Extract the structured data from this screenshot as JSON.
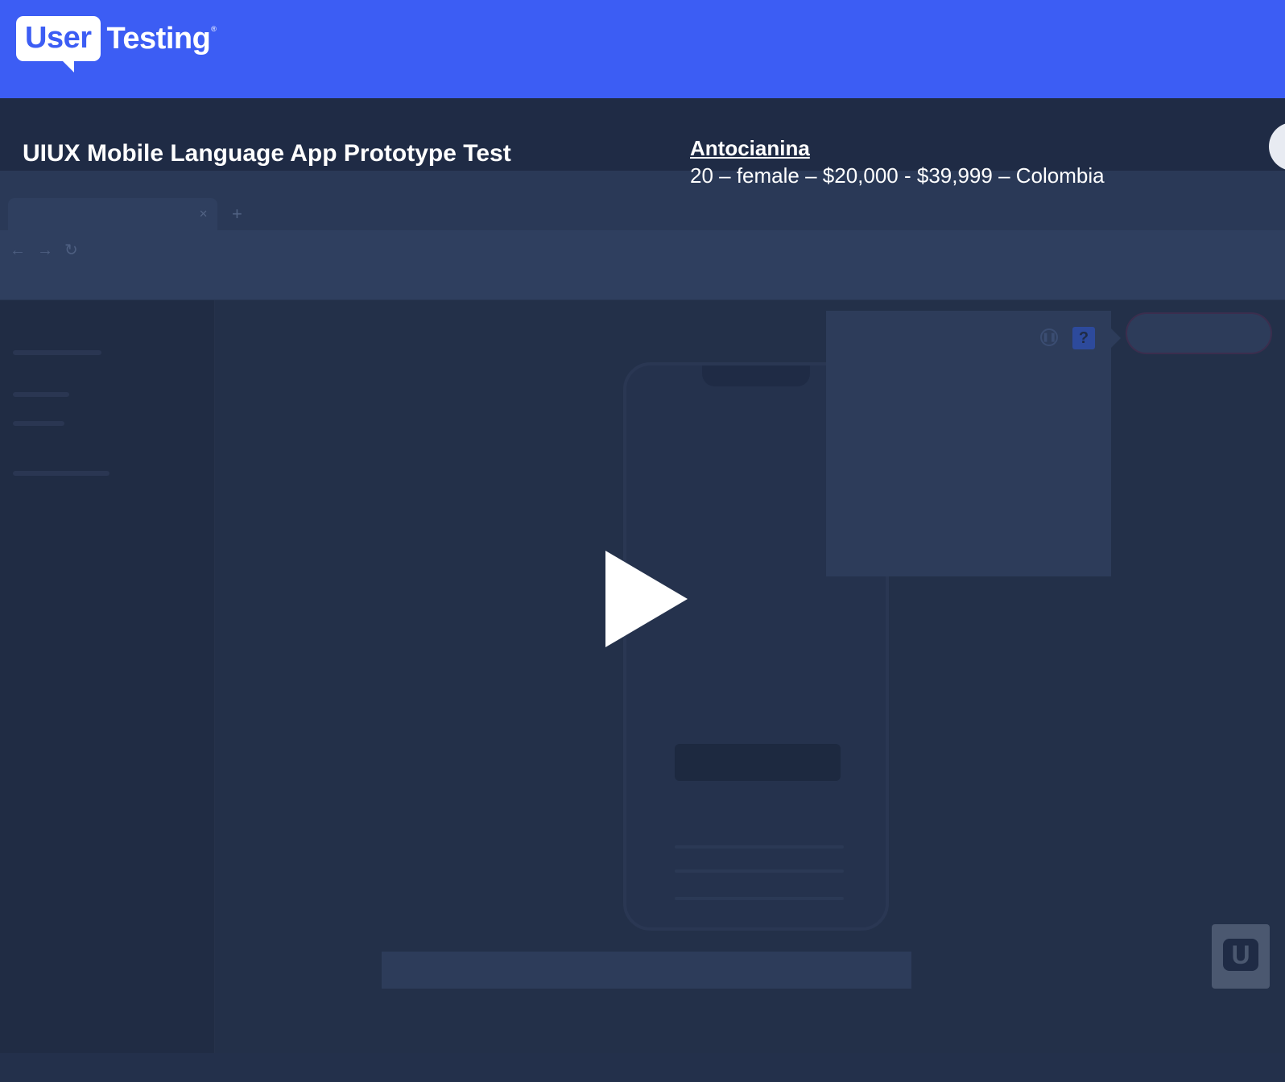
{
  "brand": {
    "logo_user": "User",
    "logo_testing": "Testing",
    "logo_reg": "®"
  },
  "test": {
    "title": "UIUX Mobile Language App Prototype Test"
  },
  "tester": {
    "name": "Antocianina",
    "demographics": "20 – female – $20,000 - $39,999 – Colombia"
  },
  "player": {
    "play_icon": "play-icon"
  },
  "colors": {
    "header": "#3c5df4",
    "background": "#1f2b45",
    "play": "#ffffff"
  }
}
